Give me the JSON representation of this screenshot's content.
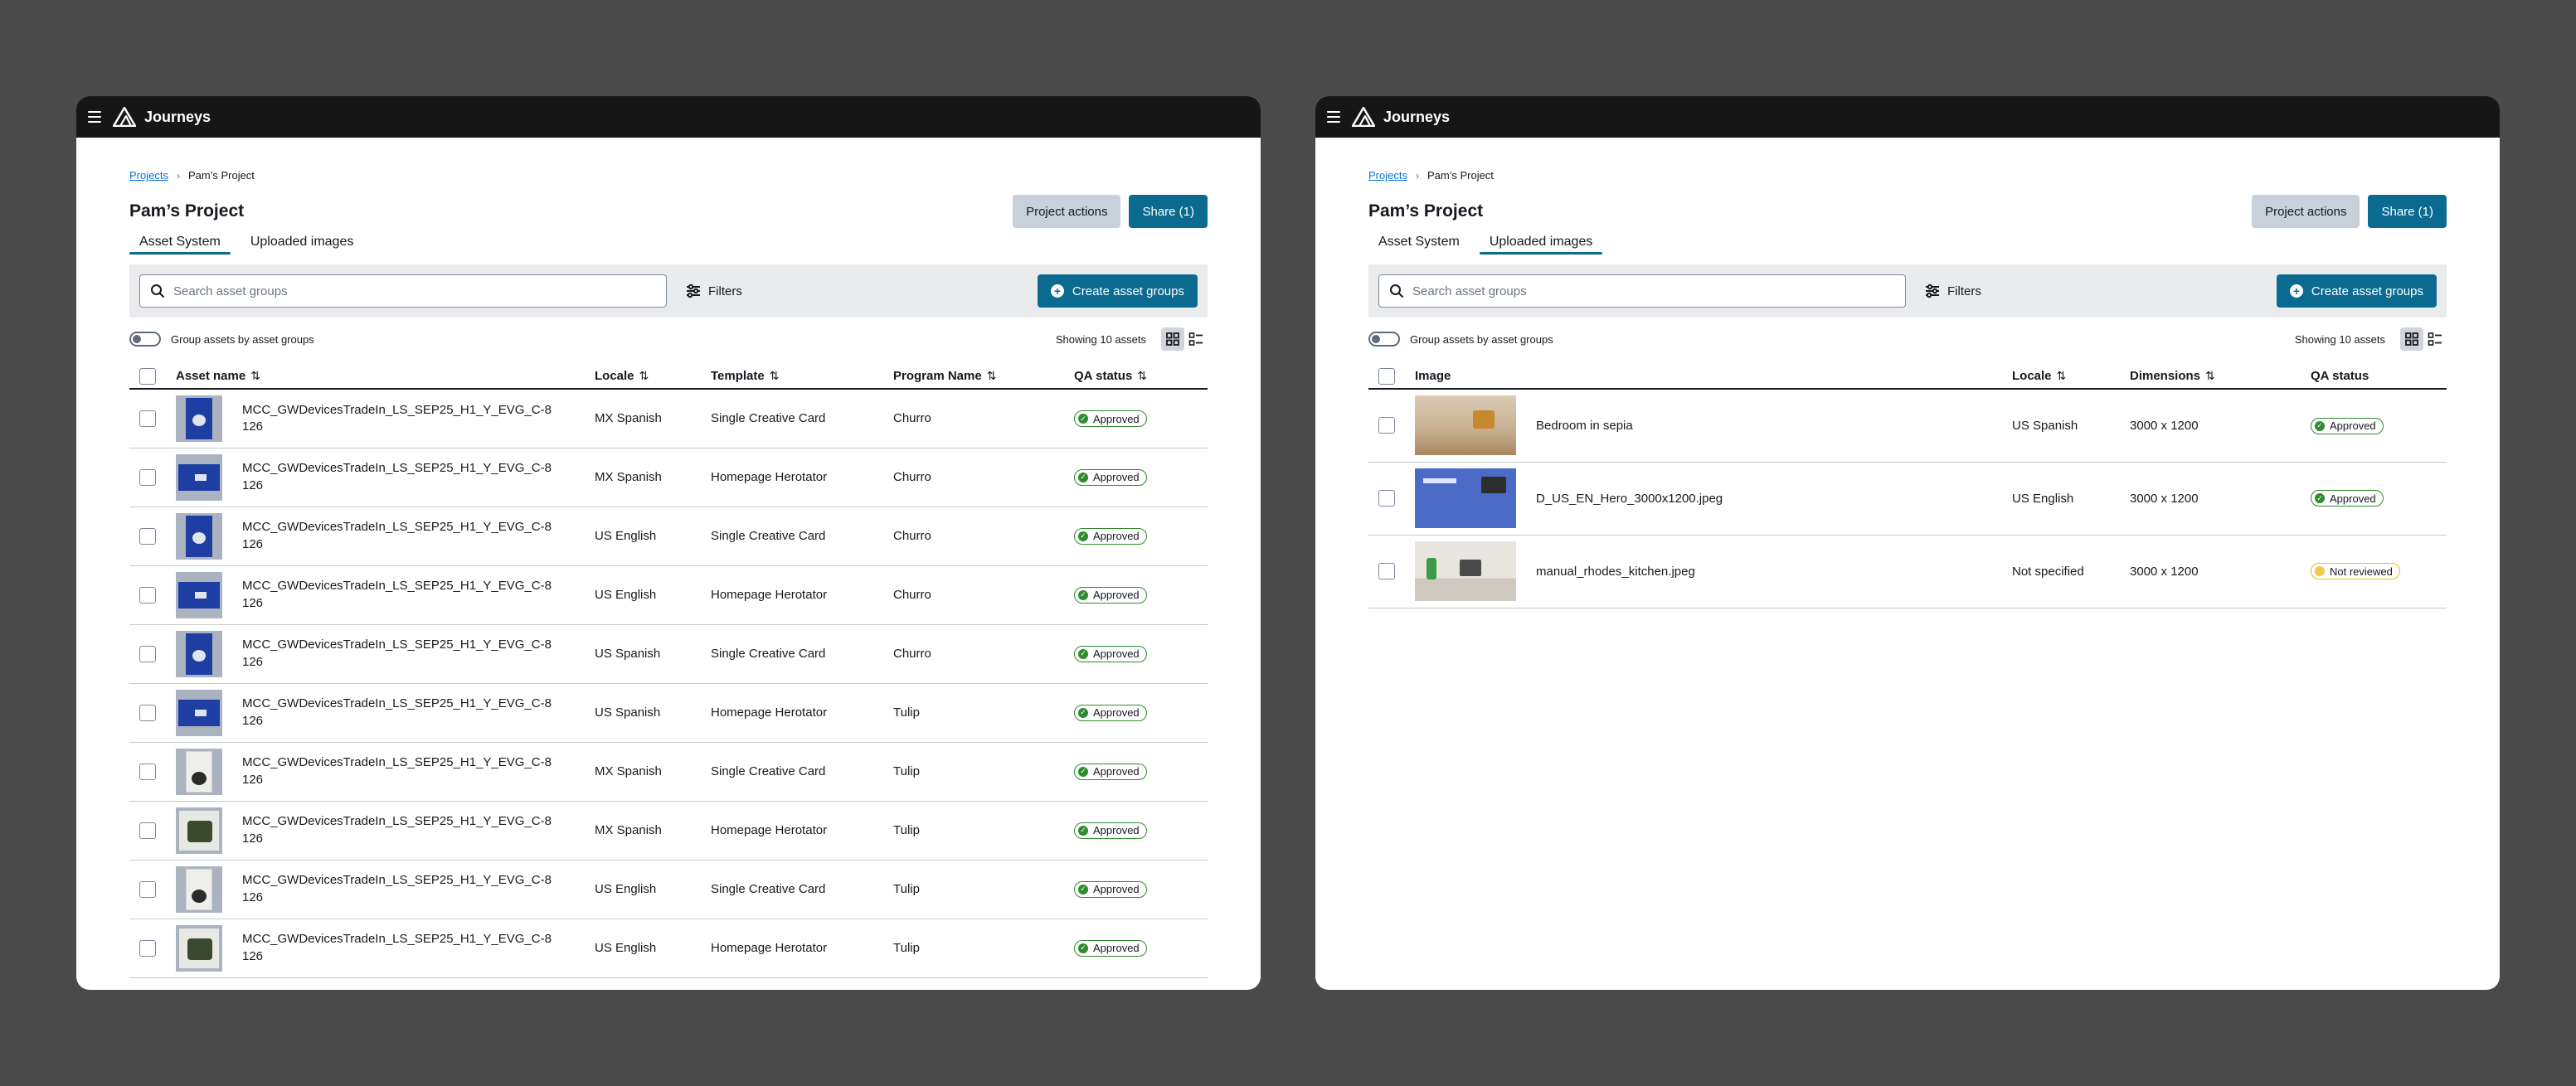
{
  "app": {
    "title": "Journeys"
  },
  "left": {
    "breadcrumb": {
      "root": "Projects",
      "current": "Pam’s Project"
    },
    "page_title": "Pam’s Project",
    "actions": {
      "project_actions": "Project actions",
      "share": "Share (1)"
    },
    "tabs": [
      {
        "label": "Asset System",
        "active": true
      },
      {
        "label": "Uploaded images",
        "active": false
      }
    ],
    "search": {
      "placeholder": "Search asset groups",
      "value": ""
    },
    "filters_label": "Filters",
    "create_label": "Create asset groups",
    "toggle_label": "Group assets by asset groups",
    "showing": "Showing 10 assets",
    "columns": {
      "asset_name": "Asset name",
      "locale": "Locale",
      "template": "Template",
      "program_name": "Program Name",
      "qa_status": "QA status"
    },
    "rows": [
      {
        "thumb": "portrait-blue",
        "name_line1": "MCC_GWDevicesTradeIn_LS_SEP25_H1_Y_EVG_C-8",
        "name_line2": "126",
        "locale": "MX Spanish",
        "template": "Single Creative Card",
        "program": "Churro",
        "status": "Approved"
      },
      {
        "thumb": "landscape-blue",
        "name_line1": "MCC_GWDevicesTradeIn_LS_SEP25_H1_Y_EVG_C-8",
        "name_line2": "126",
        "locale": "MX Spanish",
        "template": "Homepage Herotator",
        "program": "Churro",
        "status": "Approved"
      },
      {
        "thumb": "portrait-blue",
        "name_line1": "MCC_GWDevicesTradeIn_LS_SEP25_H1_Y_EVG_C-8",
        "name_line2": "126",
        "locale": "US English",
        "template": "Single Creative Card",
        "program": "Churro",
        "status": "Approved"
      },
      {
        "thumb": "landscape-blue",
        "name_line1": "MCC_GWDevicesTradeIn_LS_SEP25_H1_Y_EVG_C-8",
        "name_line2": "126",
        "locale": "US English",
        "template": "Homepage Herotator",
        "program": "Churro",
        "status": "Approved"
      },
      {
        "thumb": "portrait-blue",
        "name_line1": "MCC_GWDevicesTradeIn_LS_SEP25_H1_Y_EVG_C-8",
        "name_line2": "126",
        "locale": "US Spanish",
        "template": "Single Creative Card",
        "program": "Churro",
        "status": "Approved"
      },
      {
        "thumb": "landscape-blue",
        "name_line1": "MCC_GWDevicesTradeIn_LS_SEP25_H1_Y_EVG_C-8",
        "name_line2": "126",
        "locale": "US Spanish",
        "template": "Homepage Herotator",
        "program": "Tulip",
        "status": "Approved"
      },
      {
        "thumb": "portrait-white",
        "name_line1": "MCC_GWDevicesTradeIn_LS_SEP25_H1_Y_EVG_C-8",
        "name_line2": "126",
        "locale": "MX Spanish",
        "template": "Single Creative Card",
        "program": "Tulip",
        "status": "Approved"
      },
      {
        "thumb": "square-green",
        "name_line1": "MCC_GWDevicesTradeIn_LS_SEP25_H1_Y_EVG_C-8",
        "name_line2": "126",
        "locale": "MX Spanish",
        "template": "Homepage Herotator",
        "program": "Tulip",
        "status": "Approved"
      },
      {
        "thumb": "portrait-white",
        "name_line1": "MCC_GWDevicesTradeIn_LS_SEP25_H1_Y_EVG_C-8",
        "name_line2": "126",
        "locale": "US English",
        "template": "Single Creative Card",
        "program": "Tulip",
        "status": "Approved"
      },
      {
        "thumb": "square-green",
        "name_line1": "MCC_GWDevicesTradeIn_LS_SEP25_H1_Y_EVG_C-8",
        "name_line2": "126",
        "locale": "US English",
        "template": "Homepage Herotator",
        "program": "Tulip",
        "status": "Approved"
      }
    ]
  },
  "right": {
    "breadcrumb": {
      "root": "Projects",
      "current": "Pam’s Project"
    },
    "page_title": "Pam’s Project",
    "actions": {
      "project_actions": "Project actions",
      "share": "Share (1)"
    },
    "tabs": [
      {
        "label": "Asset System",
        "active": false
      },
      {
        "label": "Uploaded images",
        "active": true
      }
    ],
    "search": {
      "placeholder": "Search asset groups",
      "value": ""
    },
    "filters_label": "Filters",
    "create_label": "Create asset groups",
    "toggle_label": "Group assets by asset groups",
    "showing": "Showing 10 assets",
    "columns": {
      "image": "Image",
      "locale": "Locale",
      "dimensions": "Dimensions",
      "qa_status": "QA status"
    },
    "rows": [
      {
        "thumb": "bedroom",
        "name": "Bedroom in sepia",
        "locale": "US Spanish",
        "dimensions": "3000 x 1200",
        "status": "Approved",
        "status_kind": "approved"
      },
      {
        "thumb": "hero",
        "name": "D_US_EN_Hero_3000x1200.jpeg",
        "locale": "US English",
        "dimensions": "3000 x 1200",
        "status": "Approved",
        "status_kind": "approved"
      },
      {
        "thumb": "kitchen",
        "name": "manual_rhodes_kitchen.jpeg",
        "locale": "Not specified",
        "dimensions": "3000 x 1200",
        "status": "Not reviewed",
        "status_kind": "not-reviewed"
      }
    ]
  },
  "colors": {
    "topbar": "#161616",
    "primary": "#0b6a8f",
    "secondary_button": "#c8d0da",
    "approved": "#2e8b2e",
    "not_reviewed": "#f2c94c",
    "backdrop": "#4a4a4a"
  }
}
